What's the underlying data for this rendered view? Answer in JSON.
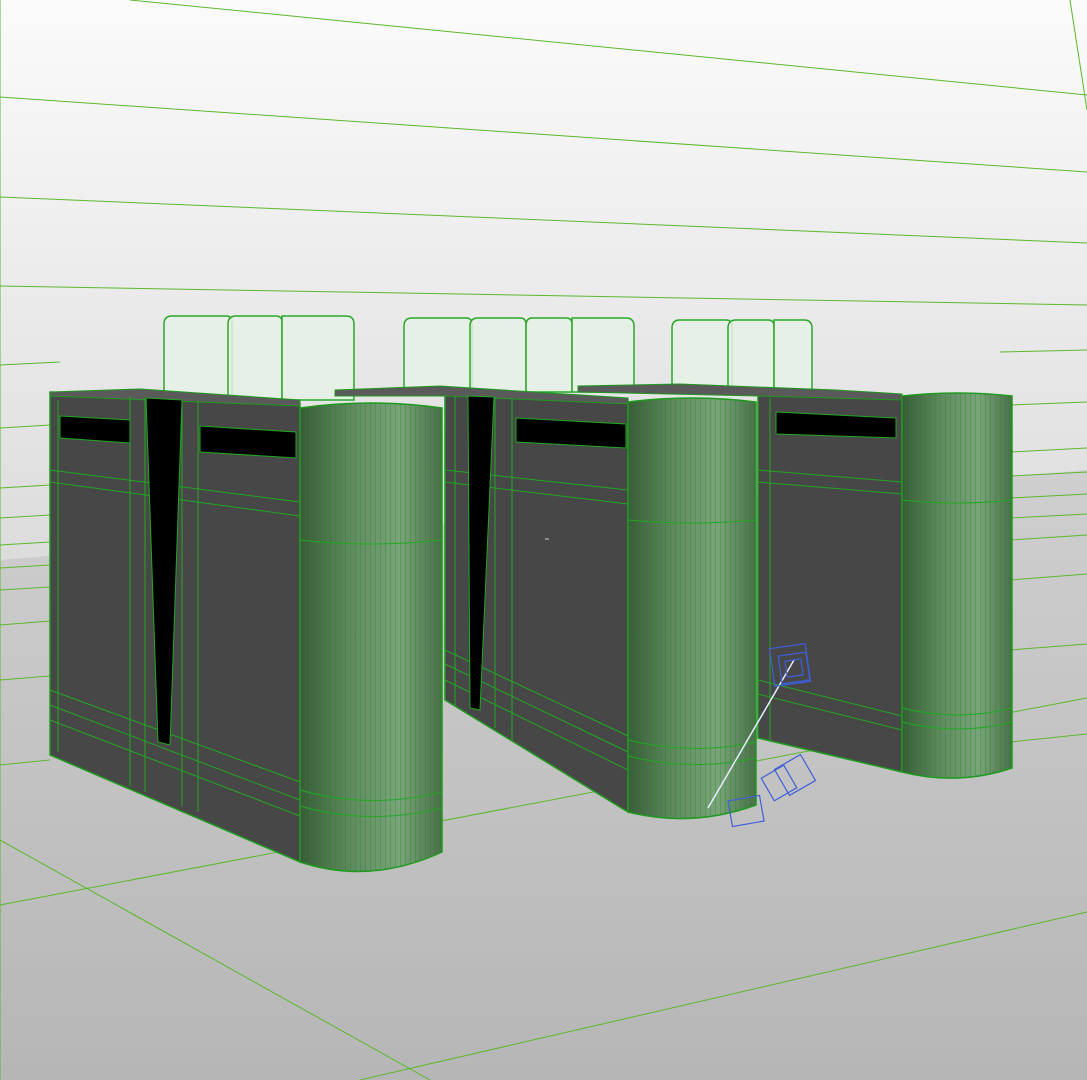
{
  "viewport": {
    "type": "3d-perspective",
    "shading": "smooth-with-wireframe-overlay"
  },
  "colors": {
    "sky_top": "#fafafa",
    "sky_bottom": "#e0e0e0",
    "floor": "#bcbcbc",
    "grid_line": "#5bb82b",
    "wireframe": "#20a020",
    "panel_face": "#474747",
    "display_slot": "#000000",
    "glass_flap": "#e8f2e8",
    "selected_object": "#3f5fd8"
  },
  "scene": {
    "objects": [
      {
        "kind": "turnstile-gate"
      },
      {
        "kind": "turnstile-gate"
      },
      {
        "kind": "turnstile-gate"
      }
    ],
    "selection": {
      "kind": "camera-target-helper"
    }
  }
}
